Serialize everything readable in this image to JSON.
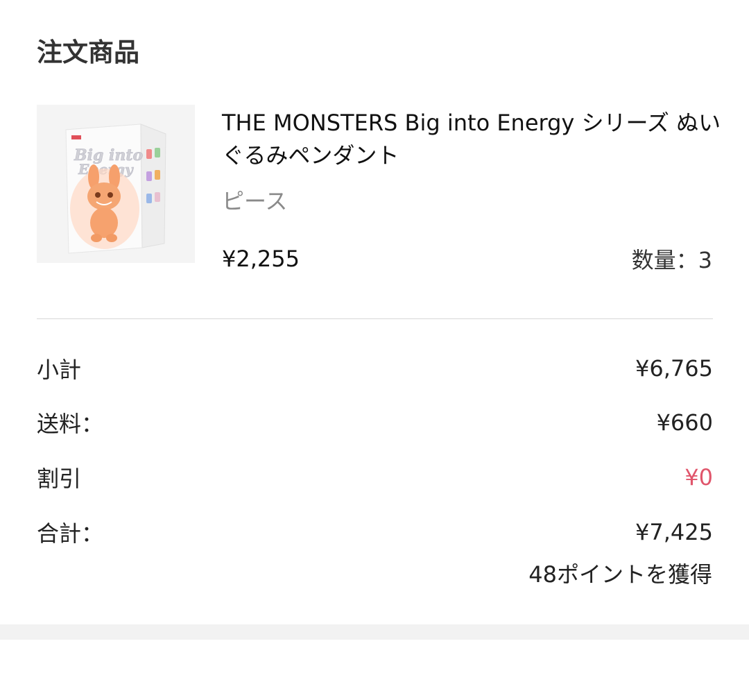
{
  "section": {
    "title": "注文商品"
  },
  "product": {
    "name": "THE MONSTERS Big into Energy シリーズ ぬいぐるみペンダント",
    "variant": "ピース",
    "price": "¥2,255",
    "quantity_label": "数量：3",
    "image_alt": "Big into Energy"
  },
  "summary": {
    "subtotal_label": "小計",
    "subtotal_value": "¥6,765",
    "shipping_label": "送料：",
    "shipping_value": "¥660",
    "discount_label": "割引",
    "discount_value": "¥0",
    "total_label": "合計：",
    "total_value": "¥7,425",
    "points": "48ポイントを獲得"
  },
  "colors": {
    "discount": "#e0556b",
    "divider": "#d6d6d6",
    "band": "#f2f2f2"
  }
}
